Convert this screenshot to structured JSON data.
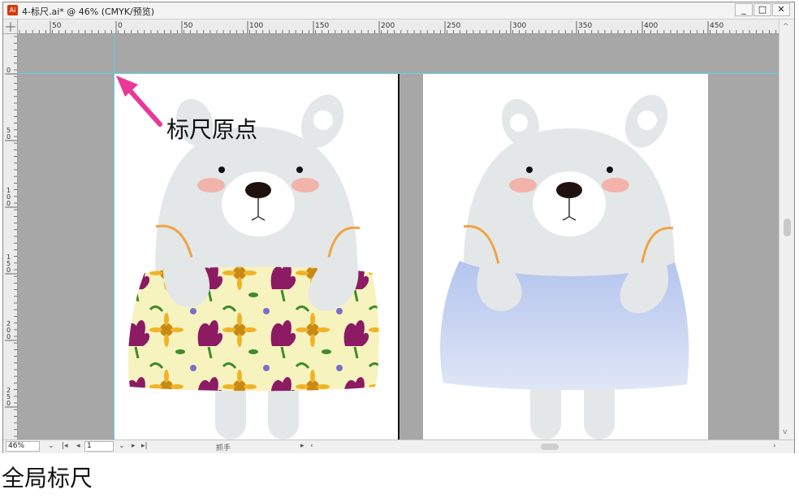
{
  "window": {
    "title": "4-标尺.ai* @ 46% (CMYK/预览)",
    "app_icon_text": "Ai",
    "minimize_symbol": "_",
    "maximize_symbol": "□",
    "close_symbol": "✕"
  },
  "rulers": {
    "horizontal_labels": [
      "50",
      "0",
      "50",
      "100",
      "150",
      "200",
      "250",
      "300",
      "350",
      "400",
      "450"
    ],
    "vertical_labels": [
      "0",
      "50",
      "100",
      "150",
      "200",
      "250"
    ]
  },
  "annotation": {
    "label": "标尺原点",
    "arrow_color": "#e8389a"
  },
  "statusbar": {
    "zoom": "46%",
    "artboard_number": "1",
    "tool": "抓手"
  },
  "caption": "全局标尺",
  "colors": {
    "guide": "#56d6e6",
    "pasteboard": "#a7a7a7",
    "bear_body": "#e3e7e7",
    "skirt_blue": "#b8c8ee",
    "skirt_pattern": "#f7f3bf",
    "cheek": "#f2b3aa",
    "arm_line": "#f0a345"
  }
}
